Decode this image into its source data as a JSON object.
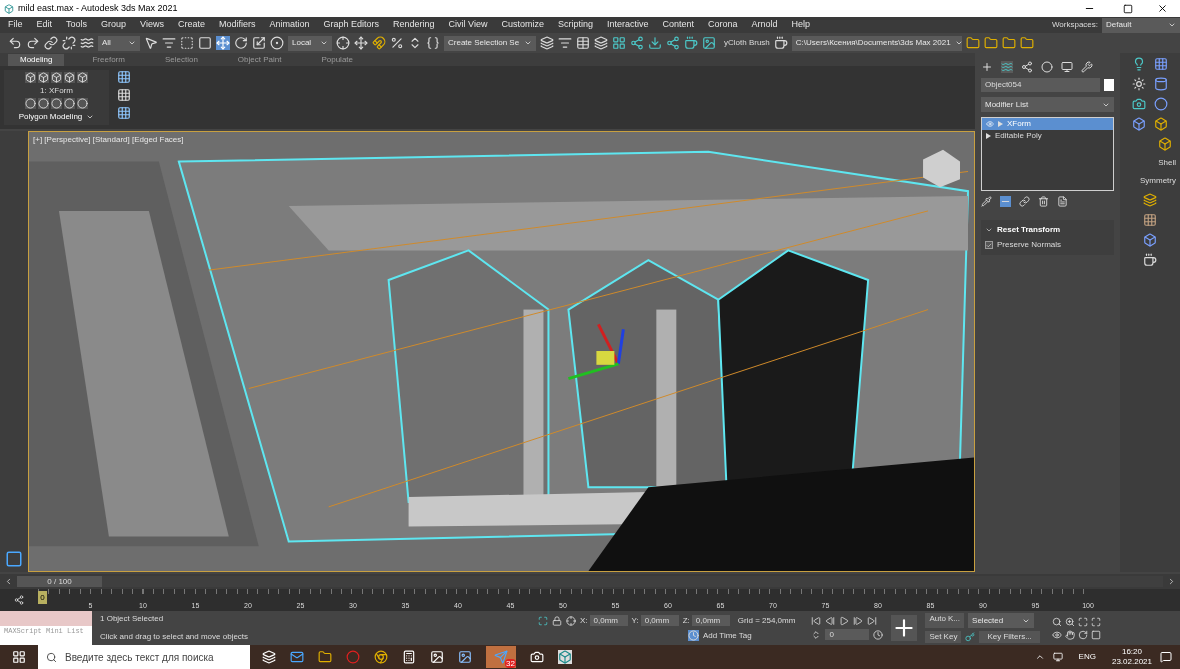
{
  "window": {
    "title": "mild east.max - Autodesk 3ds Max 2021"
  },
  "menu": [
    "File",
    "Edit",
    "Tools",
    "Group",
    "Views",
    "Create",
    "Modifiers",
    "Animation",
    "Graph Editors",
    "Rendering",
    "Civil View",
    "Customize",
    "Scripting",
    "Interactive",
    "Content",
    "Corona",
    "Arnold",
    "Help"
  ],
  "workspaces": {
    "label": "Workspaces:",
    "value": "Default"
  },
  "toolbar": {
    "selection_filter": "All",
    "reference_coordinate": "Local",
    "named_selection": "Create Selection Se",
    "cloth_brush": "yCloth Brush",
    "project_path": "C:\\Users\\Ксения\\Documents\\3ds Max 2021"
  },
  "ribbon": {
    "tabs": [
      {
        "label": "Modeling",
        "selected": true
      },
      {
        "label": "Freeform",
        "selected": false
      },
      {
        "label": "Selection",
        "selected": false
      },
      {
        "label": "Object Paint",
        "selected": false
      },
      {
        "label": "Populate",
        "selected": false
      }
    ],
    "level_label": "1: XForm",
    "panel_title": "Polygon Modeling"
  },
  "viewport": {
    "label": "[+] [Perspective] [Standard] [Edged Faces]"
  },
  "command_panel": {
    "object_name": "Object054",
    "modifier_list": "Modifier List",
    "stack": [
      {
        "label": "XForm",
        "selected": true
      },
      {
        "label": "Editable Poly",
        "selected": false
      }
    ],
    "rollout": {
      "title": "Reset Transform",
      "options": [
        {
          "label": "Preserve Normals",
          "checked": true
        }
      ]
    }
  },
  "create_strip": {
    "labels": [
      "Shell",
      "Symmetry"
    ]
  },
  "time_slider": {
    "position": "0 / 100",
    "frame": "0",
    "ticks": [
      "5",
      "10",
      "15",
      "20",
      "25",
      "30",
      "35",
      "40",
      "45",
      "50",
      "55",
      "60",
      "65",
      "70",
      "75",
      "80",
      "85",
      "90",
      "95",
      "100"
    ]
  },
  "status": {
    "maxscript": "MAXScript Mini List",
    "selection": "1 Object Selected",
    "prompt": "Click and drag to select and move objects",
    "coordinates": [
      {
        "label": "X:",
        "value": "0,0mm"
      },
      {
        "label": "Y:",
        "value": "0,0mm"
      },
      {
        "label": "Z:",
        "value": "0,0mm"
      }
    ],
    "grid": "Grid = 254,0mm",
    "time_tag": "Add Time Tag",
    "current_frame": "0",
    "auto_key": "Auto K...",
    "set_key": "Set Key",
    "key_mode": "Selected",
    "key_filters": "Key Filters..."
  },
  "taskbar": {
    "search_placeholder": "Введите здесь текст для поиска",
    "badge": "32",
    "language": "ENG",
    "time": "16:20",
    "date": "23.02.2021"
  }
}
